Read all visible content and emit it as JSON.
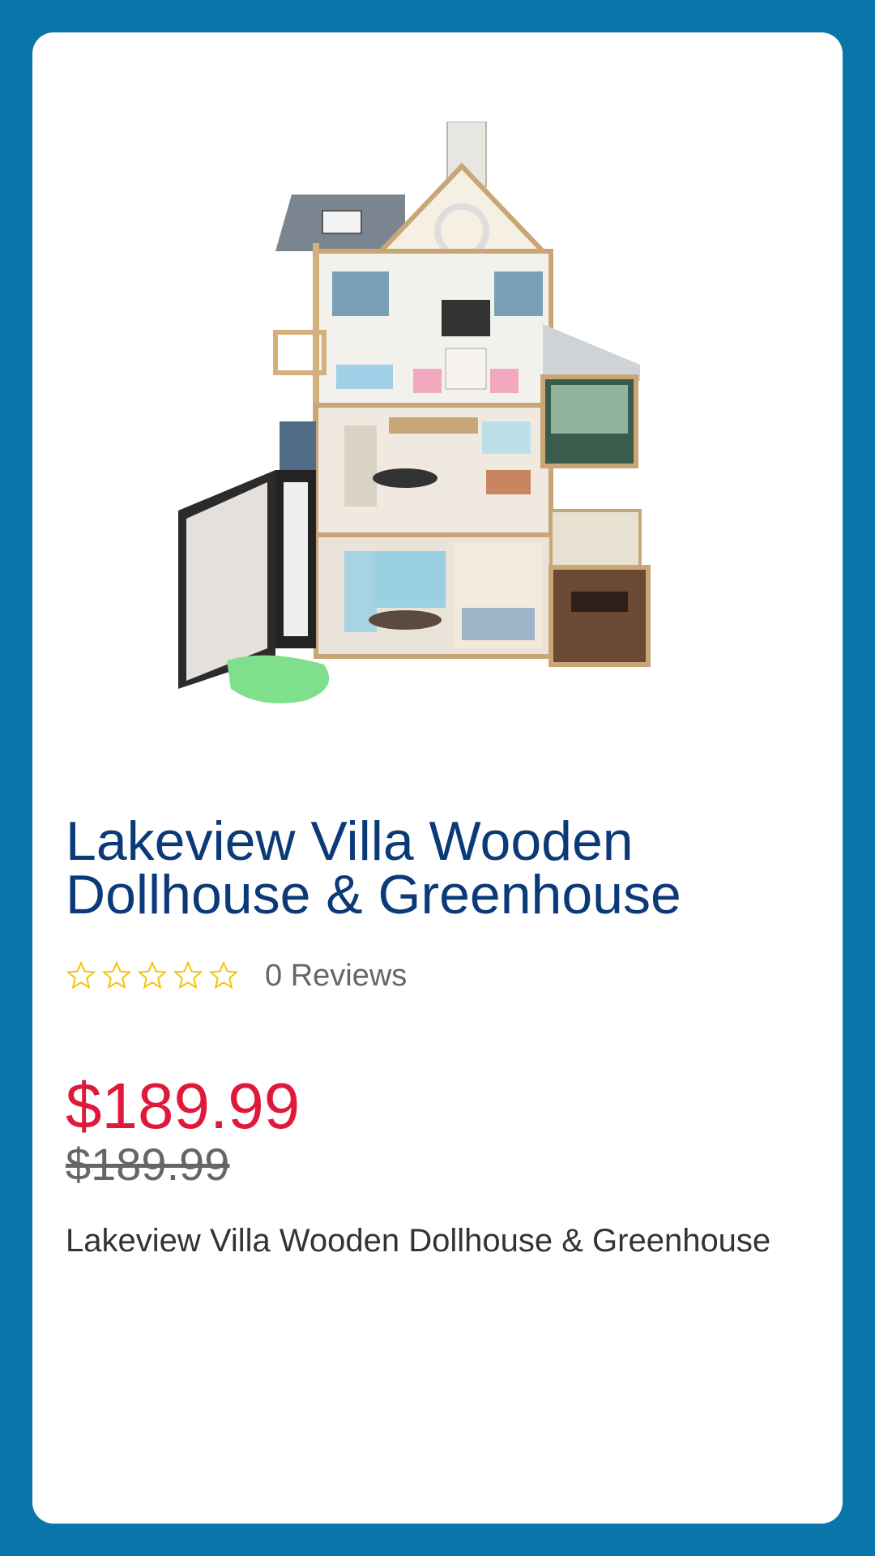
{
  "product": {
    "title": "Lakeview Villa Wooden Dollhouse & Greenhouse",
    "image_icon": "dollhouse-image",
    "rating": {
      "stars": 0,
      "max": 5,
      "reviews_text": "0 Reviews"
    },
    "price": "$189.99",
    "original_price": "$189.99",
    "description": "Lakeview Villa Wooden Dollhouse & Greenhouse"
  },
  "colors": {
    "background": "#0a75a8",
    "title": "#0b3a78",
    "price": "#e0183a",
    "star_outline": "#f2c200"
  }
}
